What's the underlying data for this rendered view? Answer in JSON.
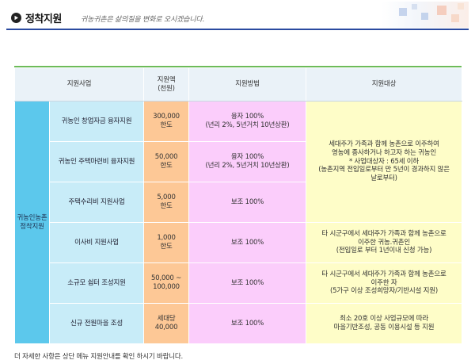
{
  "header": {
    "title": "정착지원",
    "subtitle": "귀농귀촌은 삶의질을 변화로 오시겠습니다."
  },
  "table": {
    "headers": {
      "program": "지원사업",
      "amount": "지원액\n(천원)",
      "method": "지원방법",
      "target": "지원대상"
    },
    "category": "귀농인농촌\n정착지원",
    "rows": [
      {
        "name": "귀농인 창업자금 융자지원",
        "amount": "300,000\n한도",
        "method": "융자 100%\n(년리 2%, 5년거치 10년상환)"
      },
      {
        "name": "귀농인 주택마련비 융자지원",
        "amount": "50,000\n한도",
        "method": "융자 100%\n(년리 2%, 5년거치 10년상환)"
      },
      {
        "name": "주택수리비 지원사업",
        "amount": "5,000\n한도",
        "method": "보조 100%"
      },
      {
        "name": "이사비 지원사업",
        "amount": "1,000\n한도",
        "method": "보조 100%"
      },
      {
        "name": "소규모 쉼터 조성지원",
        "amount": "50,000 ~\n100,000",
        "method": "보조 100%"
      },
      {
        "name": "신규 전원마을 조성",
        "amount": "세대당\n40,000",
        "method": "보조 100%"
      }
    ],
    "targets": [
      "세대주가 가족과 함께 농촌으로 이주하여\n영농에 종사하거나 하고자 하는 귀농인\n* 사업대상자 : 65세 이하\n(농촌지역 전입일로부터 만 5년이 경과하지 않은\n날로부터)",
      "타 시군구에서 세대주가 가족과 함께 농촌으로\n이주한 귀농.귀촌인\n(전입일로 부터 1년이내 신청 가능)",
      "타 시군구에서 세대주가 가족과 함께 농촌으로\n이주한 자\n(5가구 이상 조성희망자/기반시설 지원)",
      "최소 20호 이상 사업규모에 따라\n마을기반조성, 공동 이용시설 등 지원"
    ]
  },
  "footer": {
    "note": "더 자세한 사항은 상단 메뉴 지원안내를 확인 하시기 바랍니다."
  },
  "colors": {
    "category": "#5cc8ec",
    "program": "#c8ecf8",
    "amount": "#fdc896",
    "method": "#fbcdfb",
    "target": "#fefdc8",
    "header_rule": "#2a4aa0",
    "table_rule": "#6dbb5a"
  },
  "icons": [
    "play-circle-icon"
  ]
}
